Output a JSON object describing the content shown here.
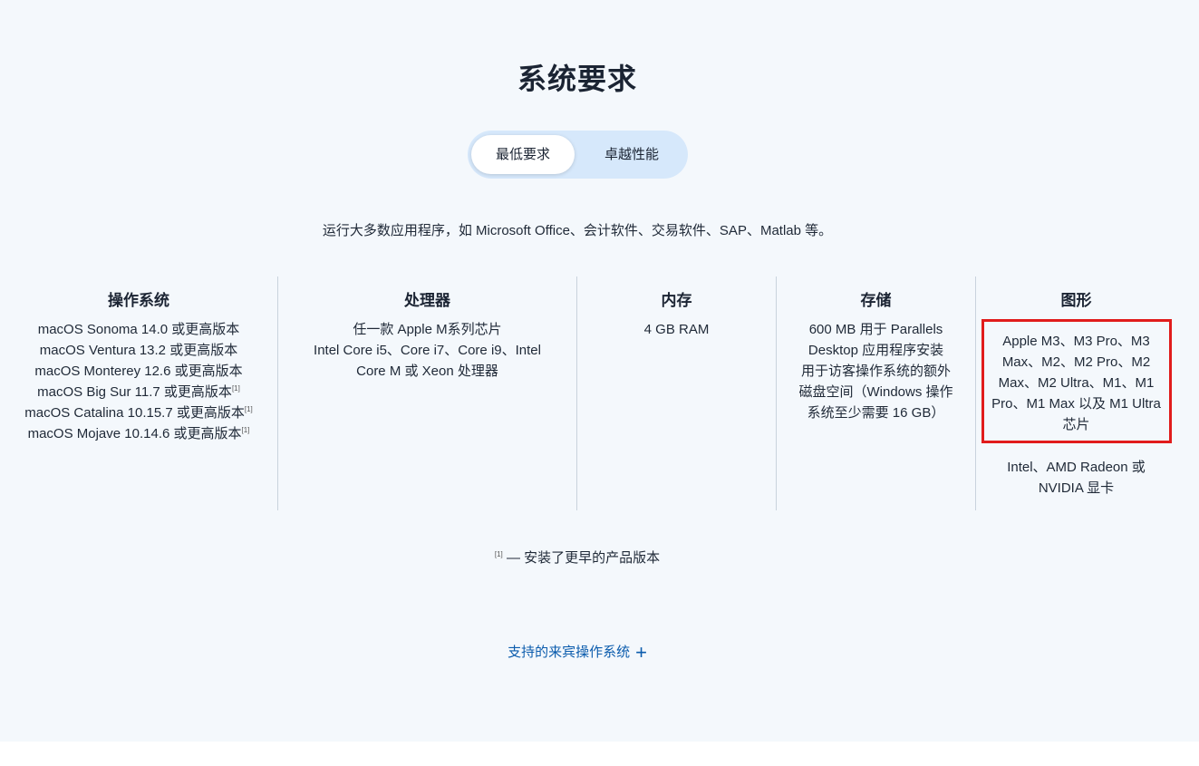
{
  "title": "系统要求",
  "tabs": [
    {
      "label": "最低要求",
      "active": true
    },
    {
      "label": "卓越性能",
      "active": false
    }
  ],
  "description": "运行大多数应用程序，如 Microsoft Office、会计软件、交易软件、SAP、Matlab 等。",
  "columns": {
    "os": {
      "heading": "操作系统",
      "lines": [
        {
          "text": "macOS Sonoma 14.0 或更高版本",
          "note": ""
        },
        {
          "text": "macOS Ventura 13.2 或更高版本",
          "note": ""
        },
        {
          "text": "macOS Monterey 12.6 或更高版本",
          "note": ""
        },
        {
          "text": "macOS Big Sur 11.7 或更高版本",
          "note": "[1]"
        },
        {
          "text": "macOS Catalina 10.15.7 或更高版本",
          "note": "[1]"
        },
        {
          "text": "macOS Mojave 10.14.6 或更高版本",
          "note": "[1]"
        }
      ]
    },
    "cpu": {
      "heading": "处理器",
      "lines": [
        "任一款 Apple M系列芯片",
        "Intel Core i5、Core i7、Core i9、Intel",
        "Core M 或 Xeon 处理器"
      ]
    },
    "ram": {
      "heading": "内存",
      "lines": [
        "4 GB RAM"
      ]
    },
    "storage": {
      "heading": "存储",
      "lines": [
        "600 MB 用于 Parallels",
        "Desktop 应用程序安装",
        "用于访客操作系统的额外",
        "磁盘空间（Windows 操作",
        "系统至少需要 16 GB）"
      ]
    },
    "graphics": {
      "heading": "图形",
      "highlight_lines": [
        "Apple M3、M3 Pro、M3",
        "Max、M2、M2 Pro、M2",
        "Max、M2 Ultra、M1、M1",
        "Pro、M1 Max 以及 M1 Ultra",
        "芯片"
      ],
      "extra_lines": [
        "Intel、AMD Radeon 或",
        "NVIDIA 显卡"
      ],
      "highlight_color": "#e11c1c"
    }
  },
  "footnote": {
    "marker": "[1]",
    "text": "— 安装了更早的产品版本"
  },
  "guest_os_link": {
    "label": "支持的来宾操作系统",
    "icon": "plus-icon"
  },
  "colors": {
    "background": "#f4f8fc",
    "toggle_bg": "#d6e8fb",
    "link": "#0b5cad"
  }
}
